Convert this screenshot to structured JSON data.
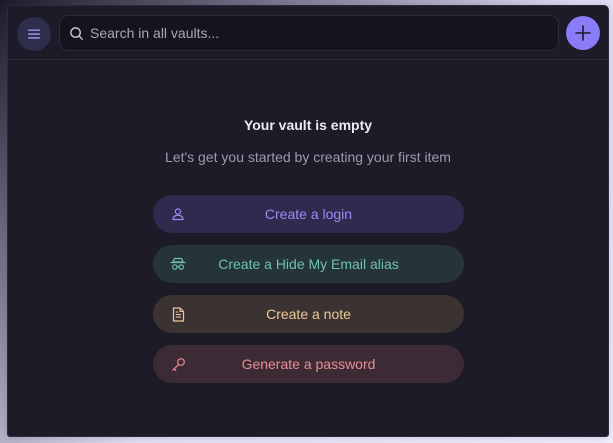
{
  "header": {
    "menu_icon": "hamburger-menu-icon",
    "search_icon": "search-icon",
    "search_placeholder": "Search in all vaults...",
    "search_value": "",
    "add_icon": "plus-icon"
  },
  "empty_state": {
    "title": "Your vault is empty",
    "subtitle": "Let's get you started by creating your first item"
  },
  "actions": [
    {
      "label": "Create a login",
      "icon": "user-icon",
      "color": "#a288f3"
    },
    {
      "label": "Create a Hide My Email alias",
      "icon": "alias-mask-icon",
      "color": "#6fc1a7"
    },
    {
      "label": "Create a note",
      "icon": "note-document-icon",
      "color": "#edc99a"
    },
    {
      "label": "Generate a password",
      "icon": "key-icon",
      "color": "#e98d93"
    }
  ],
  "colors": {
    "accent": "#8a7cf7",
    "background": "#1c1b27"
  }
}
